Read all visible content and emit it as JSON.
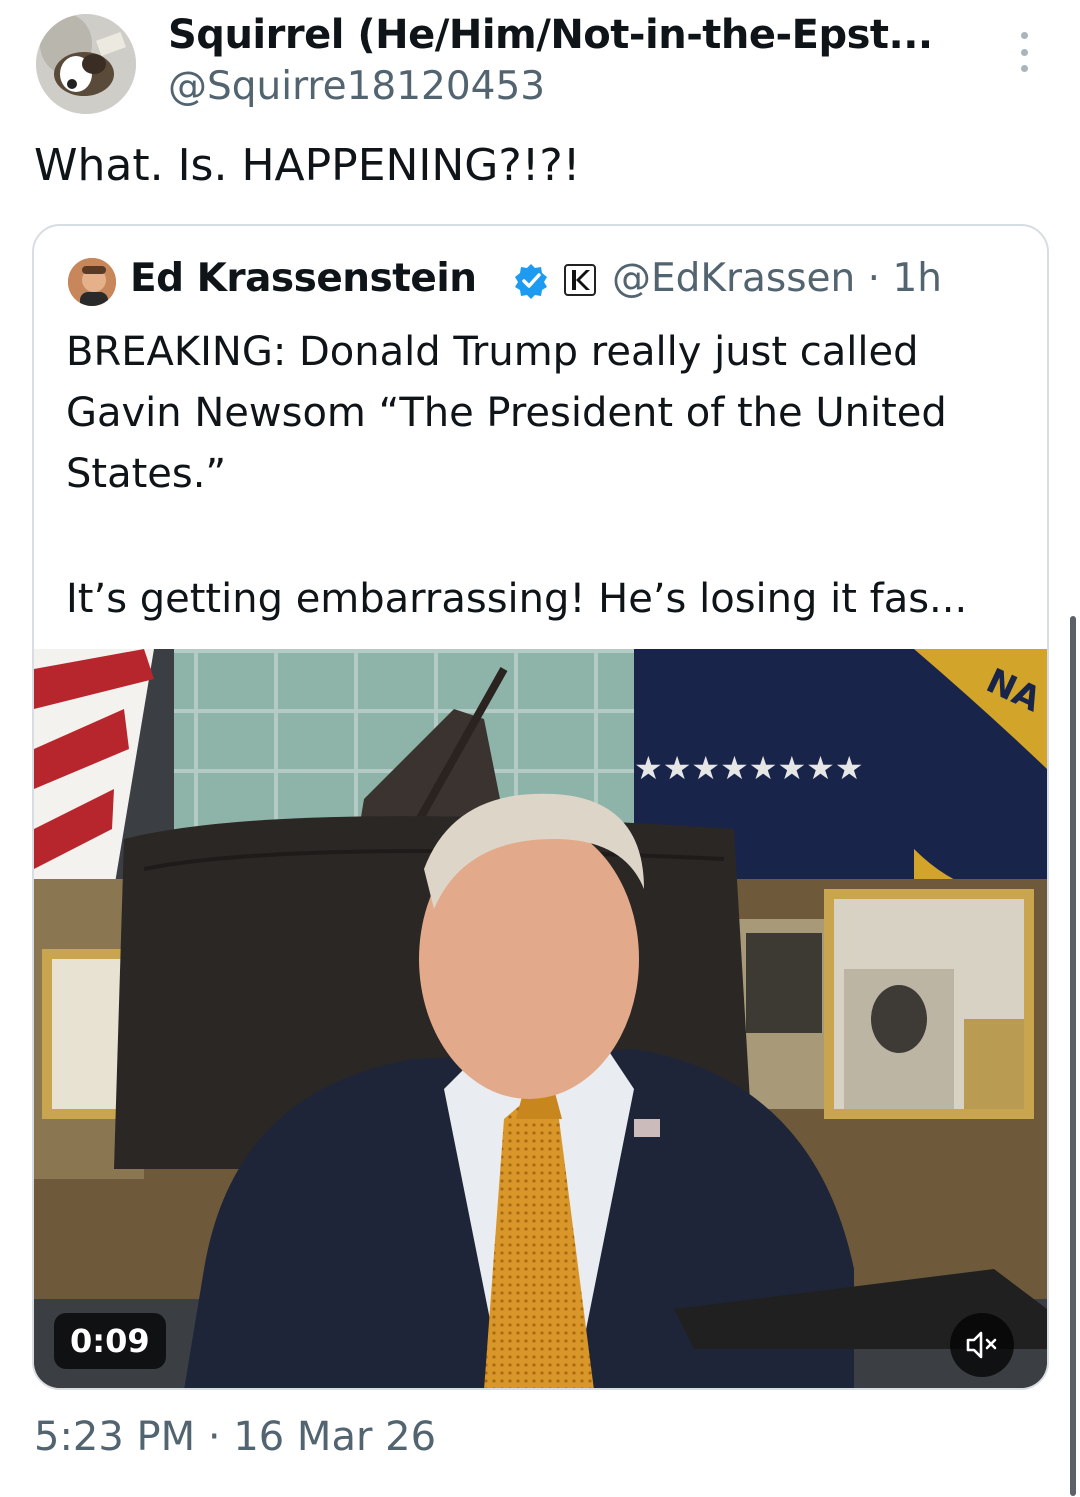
{
  "post": {
    "author": {
      "display_name": "Squirrel (He/Him/Not-in-the-Epst...",
      "handle": "@Squirre18120453",
      "avatar_icon": "dog-avatar"
    },
    "text": "What. Is. HAPPENING?!?!",
    "timestamp": "5:23 PM · 16 Mar 26",
    "more_icon": "more-vertical-icon"
  },
  "quote": {
    "author": {
      "display_name": "Ed Krassenstein",
      "handle_time": "@EdKrassen · 1h",
      "verified_icon": "verified-badge-icon",
      "affiliate_icon": "affiliate-k-icon"
    },
    "lines": [
      "BREAKING: Donald Trump really just called",
      "Gavin Newsom “The President of the United",
      "States.”"
    ],
    "line_after_gap": "It’s getting embarrassing! He’s losing it fas...",
    "video": {
      "duration": "0:09",
      "mute_icon": "speaker-muted-icon",
      "flag_text": "NA"
    }
  },
  "colors": {
    "text_primary": "#0f1419",
    "text_secondary": "#536471",
    "verified_blue": "#1d9bf0",
    "card_border": "#d7dde2"
  }
}
